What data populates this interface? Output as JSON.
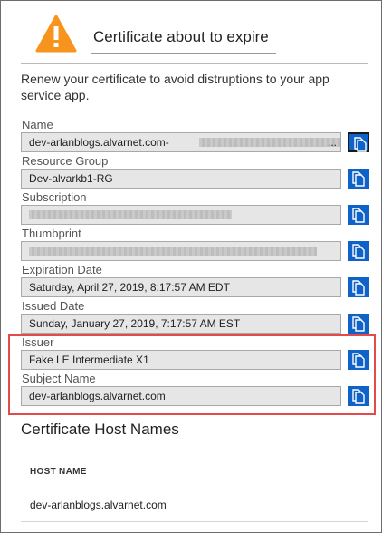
{
  "dialog": {
    "title": "Certificate about to expire",
    "description": "Renew your certificate to avoid distruptions to your app service app."
  },
  "fields": [
    {
      "label": "Name",
      "value": "dev-arlanblogs.alvarnet.com-",
      "redacted": true,
      "truncated_marker": "..."
    },
    {
      "label": "Resource Group",
      "value": "Dev-alvarkb1-RG"
    },
    {
      "label": "Subscription",
      "value": "",
      "redacted": true
    },
    {
      "label": "Thumbprint",
      "value": "",
      "redacted": true
    },
    {
      "label": "Expiration Date",
      "value": "Saturday, April 27, 2019, 8:17:57 AM EDT"
    },
    {
      "label": "Issued Date",
      "value": "Sunday, January 27, 2019, 7:17:57 AM EST"
    },
    {
      "label": "Issuer",
      "value": "Fake LE Intermediate X1"
    },
    {
      "label": "Subject Name",
      "value": "dev-arlanblogs.alvarnet.com"
    }
  ],
  "host_names": {
    "title": "Certificate Host Names",
    "column_header": "HOST NAME",
    "rows": [
      "dev-arlanblogs.alvarnet.com"
    ]
  },
  "colors": {
    "warning": "#f7941d",
    "copy_button": "#0f62c8",
    "highlight_border": "#e34a4a"
  },
  "icons": {
    "warning": "warning-triangle-icon",
    "copy": "copy-icon"
  }
}
